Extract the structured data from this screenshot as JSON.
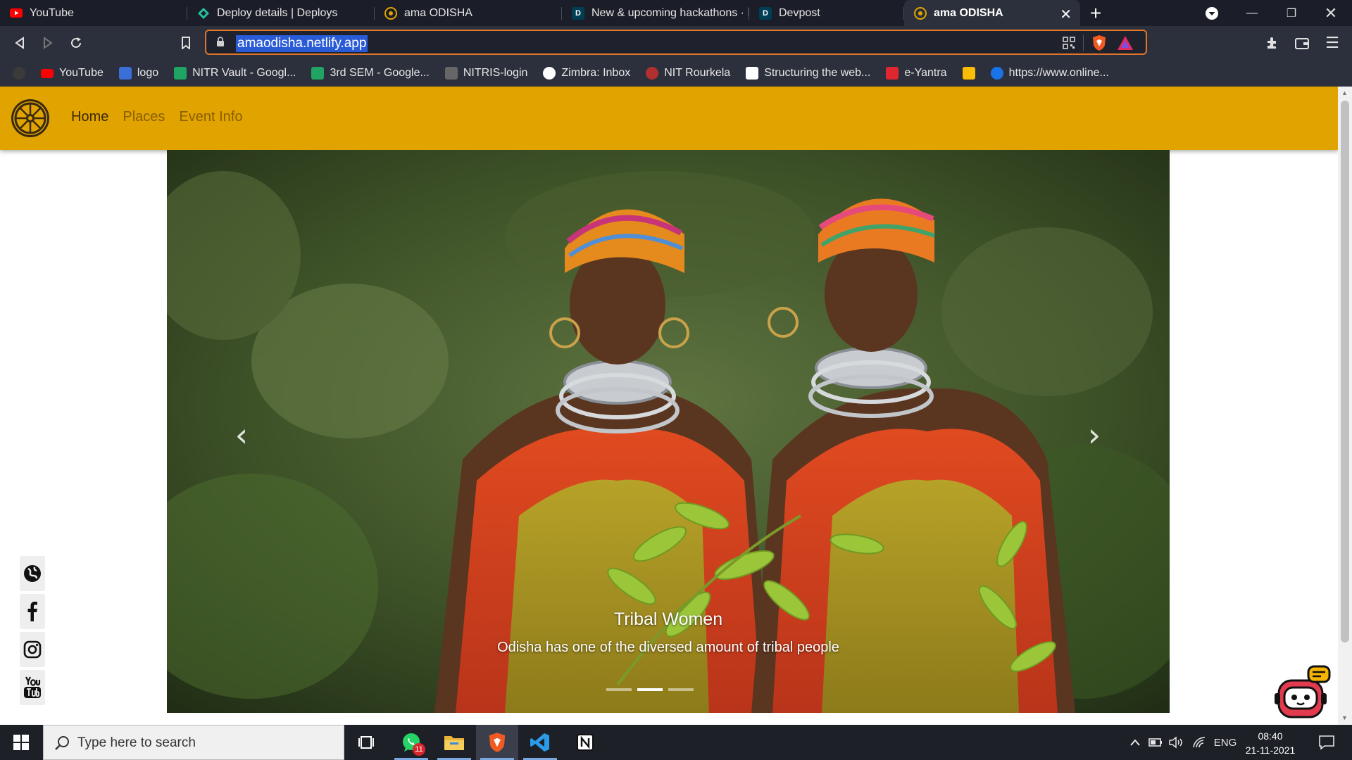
{
  "browser": {
    "tabs": [
      {
        "title": "YouTube",
        "icon": "youtube-icon",
        "active": false
      },
      {
        "title": "Deploy details | Deploys",
        "icon": "netlify-icon",
        "active": false
      },
      {
        "title": "ama ODISHA",
        "icon": "site-logo-icon",
        "active": false
      },
      {
        "title": "New & upcoming hackathons · D",
        "icon": "devpost-icon",
        "icon_letter": "D",
        "active": false
      },
      {
        "title": "Devpost",
        "icon": "devpost-icon",
        "icon_letter": "D",
        "active": false
      },
      {
        "title": "ama ODISHA",
        "icon": "site-logo-icon",
        "active": true
      }
    ],
    "url": "amaodisha.netlify.app",
    "bookmarks": [
      {
        "label": "",
        "icon": "dark-circle-icon",
        "color": "#3a3a3a"
      },
      {
        "label": "YouTube",
        "icon": "youtube-icon",
        "color": "#ff0000"
      },
      {
        "label": "logo",
        "icon": "logo-swirl-icon",
        "color": "#3b6fd8"
      },
      {
        "label": "NITR Vault - Googl...",
        "icon": "google-drive-icon",
        "color": "#1fa463"
      },
      {
        "label": "3rd SEM - Google...",
        "icon": "google-drive-icon",
        "color": "#1fa463"
      },
      {
        "label": "NITRIS-login",
        "icon": "nitris-icon",
        "color": "#666666"
      },
      {
        "label": "Zimbra: Inbox",
        "icon": "zimbra-icon",
        "color": "#ffffff"
      },
      {
        "label": "NIT Rourkela",
        "icon": "nit-rourkela-icon",
        "color": "#b03030"
      },
      {
        "label": "Structuring the web...",
        "icon": "freecodecamp-icon",
        "color": "#ffffff"
      },
      {
        "label": "e-Yantra",
        "icon": "e-yantra-icon",
        "color": "#e0262f"
      },
      {
        "label": "",
        "icon": "google-photos-icon",
        "color": "#fbbc05"
      },
      {
        "label": "https://www.online...",
        "icon": "info-circle-icon",
        "color": "#1a73e8"
      }
    ]
  },
  "site": {
    "nav": [
      {
        "label": "Home",
        "active": true
      },
      {
        "label": "Places",
        "active": false
      },
      {
        "label": "Event Info",
        "active": false
      }
    ],
    "carousel": {
      "caption_title": "Tribal Women",
      "caption_text": "Odisha has one of the diversed amount of tribal people",
      "prev_symbol": "‹",
      "next_symbol": "›",
      "slide_count": 3,
      "active_slide": 2
    },
    "social": [
      {
        "name": "globe-icon"
      },
      {
        "name": "facebook-icon"
      },
      {
        "name": "instagram-icon"
      },
      {
        "name": "youtube-icon"
      }
    ],
    "brand_color": "#e0a300"
  },
  "taskbar": {
    "search_placeholder": "Type here to search",
    "whatsapp_badge": "11",
    "language": "ENG",
    "time": "08:40",
    "date": "21-11-2021"
  }
}
